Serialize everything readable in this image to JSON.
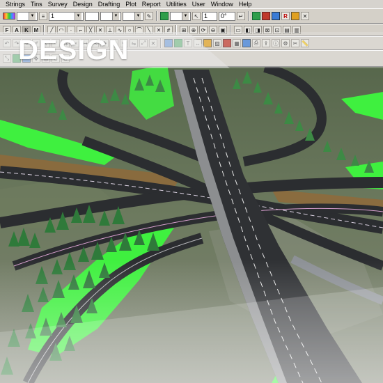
{
  "menu": [
    "Strings",
    "Tins",
    "Survey",
    "Design",
    "Drafting",
    "Plot",
    "Report",
    "Utilities",
    "User",
    "Window",
    "Help"
  ],
  "toolbar": {
    "combo_value_1": "1",
    "combo_value_2": "1",
    "angle_value": "0°",
    "text_buttons": [
      "F",
      "A",
      "K",
      "M"
    ]
  },
  "banner": {
    "title": "DESIGN"
  },
  "colors": {
    "banner_overlay": "#e9e9e9",
    "road": "#2b2d30",
    "grass": "#3ff03f",
    "terrain": "#5e6b4f"
  }
}
